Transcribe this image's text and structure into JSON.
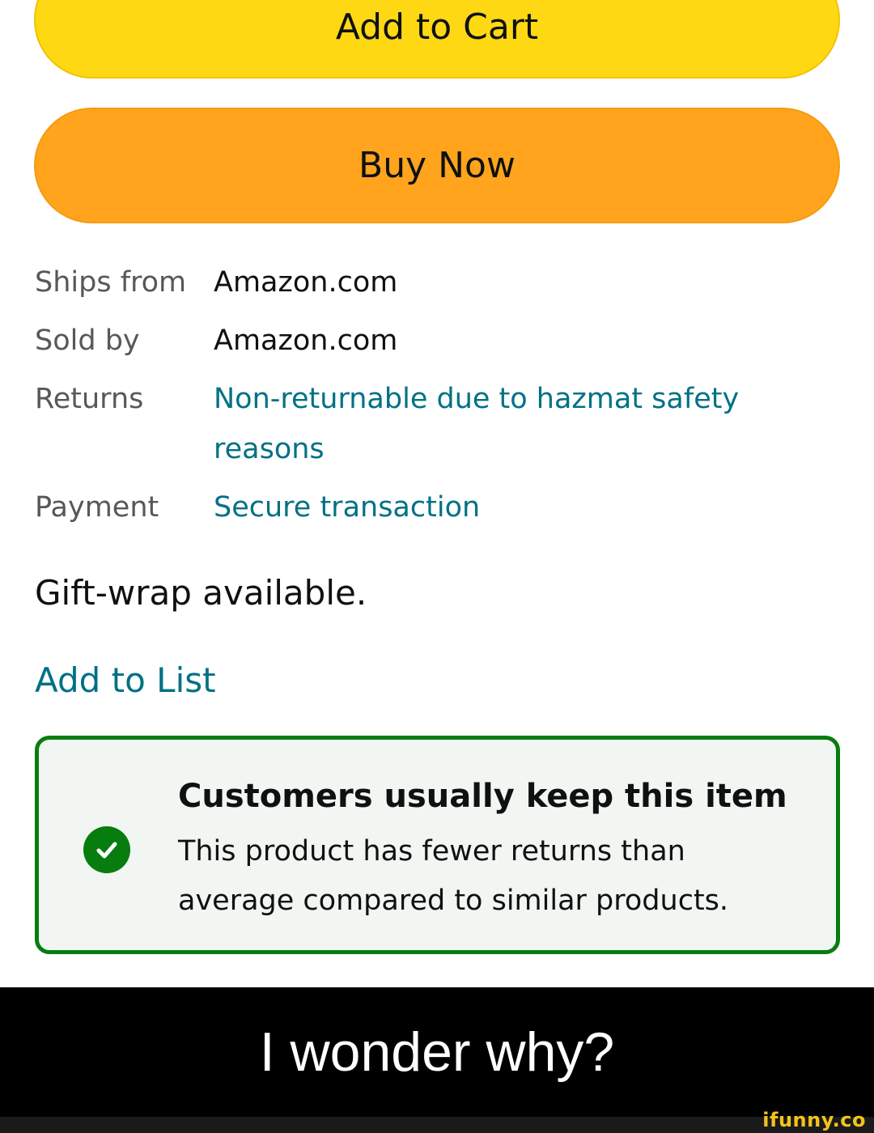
{
  "buttons": {
    "add_to_cart": "Add to Cart",
    "buy_now": "Buy Now"
  },
  "info": {
    "ships_from_label": "Ships from",
    "ships_from_value": "Amazon.com",
    "sold_by_label": "Sold by",
    "sold_by_value": "Amazon.com",
    "returns_label": "Returns",
    "returns_value": "Non-returnable due to hazmat safety reasons",
    "payment_label": "Payment",
    "payment_value": "Secure transaction"
  },
  "gift_wrap": "Gift-wrap available.",
  "add_to_list": "Add to List",
  "keep_box": {
    "title": "Customers usually keep this item",
    "description": "This product has fewer returns than average compared to similar products.",
    "icon": "checkmark-icon"
  },
  "caption": "I wonder why?",
  "watermark": "ifunny.co",
  "colors": {
    "add_to_cart_bg": "#ffd814",
    "buy_now_bg": "#ffa41c",
    "link": "#007185",
    "keep_border": "#067d0e",
    "keep_bg": "#f1f6f2"
  }
}
